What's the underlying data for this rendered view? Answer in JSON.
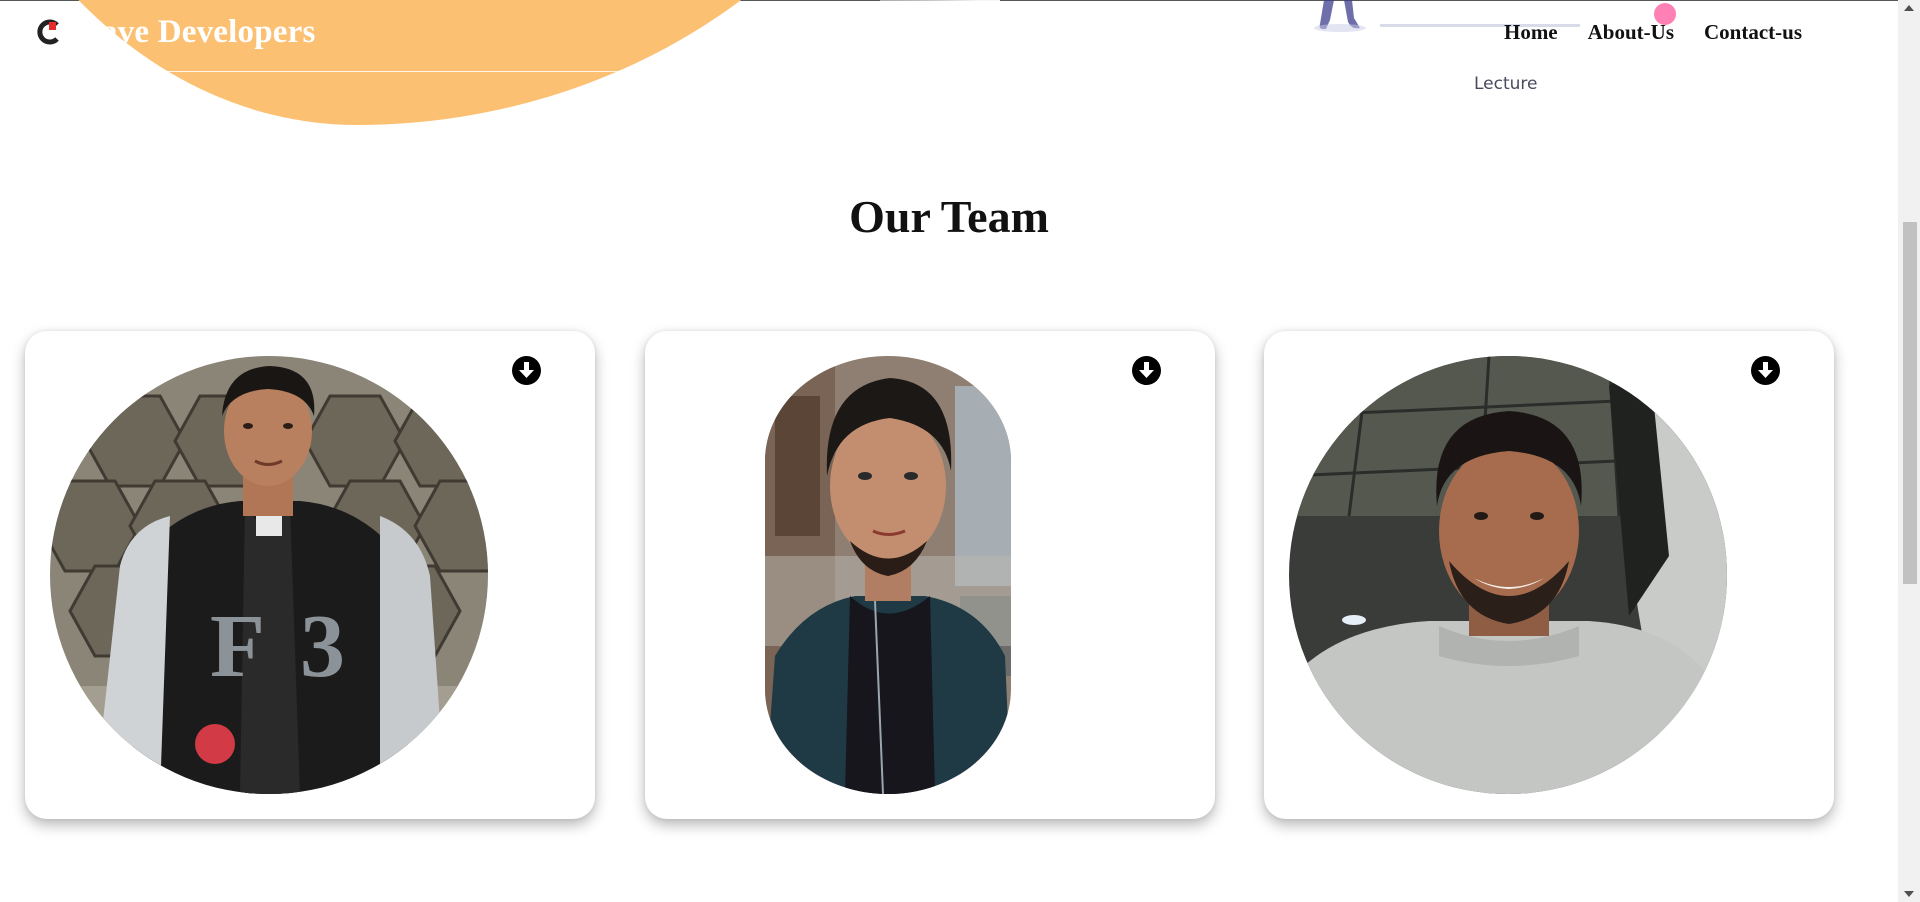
{
  "brand": {
    "name": "Cave Developers",
    "icon": "cave-logo-icon"
  },
  "nav": {
    "home": "Home",
    "about": "About-Us",
    "contact": "Contact-us"
  },
  "hero": {
    "caption": "Lecture"
  },
  "team": {
    "title": "Our Team",
    "members": [
      {
        "photo": "team-photo-1",
        "download_icon": "download-icon"
      },
      {
        "photo": "team-photo-2",
        "download_icon": "download-icon"
      },
      {
        "photo": "team-photo-3",
        "download_icon": "download-icon"
      }
    ]
  },
  "colors": {
    "header_accent": "#fcc072",
    "logo_red": "#e32b2b",
    "text": "#111111"
  }
}
